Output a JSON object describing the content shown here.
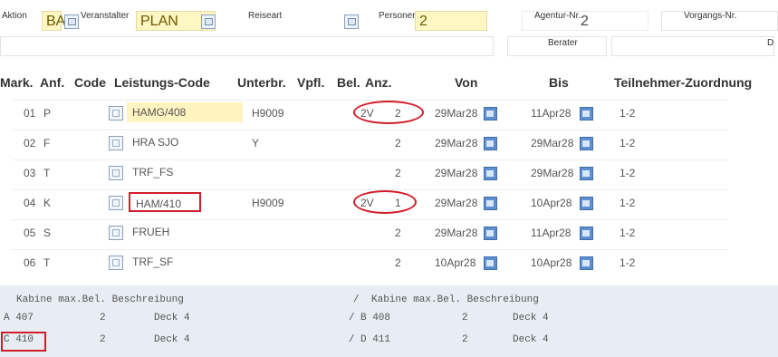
{
  "header": {
    "aktion_label": "Aktion",
    "aktion_value": "BA",
    "veranstalter_label": "Veranstalter",
    "veranstalter_value": "PLAN",
    "reiseart_label": "Reiseart",
    "personen_label": "Personen",
    "personen_value": "2",
    "agentur_label": "Agentur-Nr.",
    "agentur_value": "2",
    "vorgang_label": "Vorgangs-Nr.",
    "berater_label": "Berater",
    "truncated_value": "D"
  },
  "table": {
    "headers": {
      "mark": "Mark.",
      "anf": "Anf.",
      "code": "Code",
      "leistung": "Leistungs-Code",
      "unterbr": "Unterbr.",
      "vpfl": "Vpfl.",
      "bel": "Bel.",
      "anz": "Anz.",
      "von": "Von",
      "bis": "Bis",
      "teilnehmer": "Teilnehmer-Zuordnung"
    },
    "rows": [
      {
        "nr": "01",
        "anf": "P",
        "leistung": "HAMG/408",
        "unterbr": "H9009",
        "vpfl": "2V",
        "anz": "2",
        "von": "29Mar28",
        "bis": "11Apr28",
        "tn": "1-2"
      },
      {
        "nr": "02",
        "anf": "F",
        "leistung": "HRA SJO",
        "unterbr": "Y",
        "vpfl": "",
        "anz": "2",
        "von": "29Mar28",
        "bis": "29Mar28",
        "tn": "1-2"
      },
      {
        "nr": "03",
        "anf": "T",
        "leistung": "TRF_FS",
        "unterbr": "",
        "vpfl": "",
        "anz": "2",
        "von": "29Mar28",
        "bis": "29Mar28",
        "tn": "1-2"
      },
      {
        "nr": "04",
        "anf": "K",
        "leistung": "HAM/410",
        "unterbr": "H9009",
        "vpfl": "2V",
        "anz": "1",
        "von": "29Mar28",
        "bis": "10Apr28",
        "tn": "1-2"
      },
      {
        "nr": "05",
        "anf": "S",
        "leistung": "FRUEH",
        "unterbr": "",
        "vpfl": "",
        "anz": "2",
        "von": "29Mar28",
        "bis": "11Apr28",
        "tn": "1-2"
      },
      {
        "nr": "06",
        "anf": "T",
        "leistung": "TRF_SF",
        "unterbr": "",
        "vpfl": "",
        "anz": "2",
        "von": "10Apr28",
        "bis": "10Apr28",
        "tn": "1-2"
      }
    ]
  },
  "cabins": {
    "header_left": "Kabine max.Bel. Beschreibung",
    "header_right": "Kabine max.Bel. Beschreibung",
    "separator": "/",
    "rows": [
      {
        "left_code": "A 407",
        "left_bel": "2",
        "left_desc": "Deck 4",
        "right_code": "B 408",
        "right_bel": "2",
        "right_desc": "Deck 4"
      },
      {
        "left_code": "C 410",
        "left_bel": "2",
        "left_desc": "Deck 4",
        "right_code": "D 411",
        "right_bel": "2",
        "right_desc": "Deck 4"
      }
    ]
  },
  "colors": {
    "highlight": "#d21d2a",
    "input_yellow": "#fff6c4",
    "panel_blue": "#e7edf3"
  }
}
